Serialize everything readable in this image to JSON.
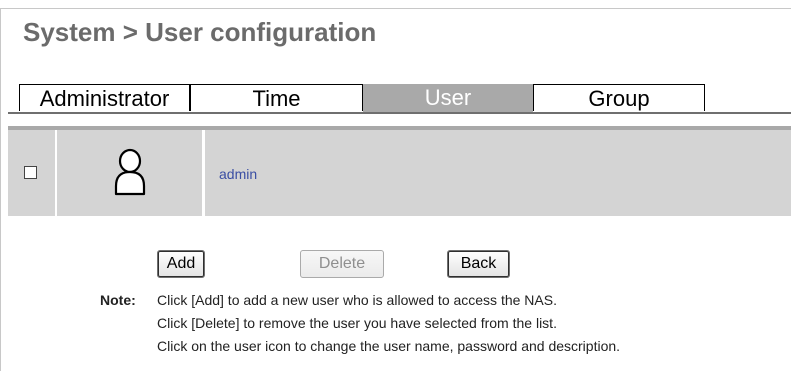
{
  "page": {
    "title": "System > User configuration"
  },
  "tabs": [
    {
      "label": "Administrator",
      "active": false
    },
    {
      "label": "Time",
      "active": false
    },
    {
      "label": "User",
      "active": true
    },
    {
      "label": "Group",
      "active": false
    }
  ],
  "users": [
    {
      "name": "admin",
      "checked": false,
      "icon": "user-icon"
    }
  ],
  "buttons": {
    "add": "Add",
    "delete": "Delete",
    "back": "Back"
  },
  "note": {
    "label": "Note:",
    "lines": [
      "Click [Add] to add a new user who is allowed to access the NAS.",
      "Click [Delete] to remove the user you have selected from the list.",
      "Click on the user icon to change the user name, password and description."
    ]
  },
  "colors": {
    "title": "#6b6b6b",
    "active_tab": "#a9a9a9",
    "row_bg": "#d4d4d4",
    "link": "#3a4ea3"
  }
}
